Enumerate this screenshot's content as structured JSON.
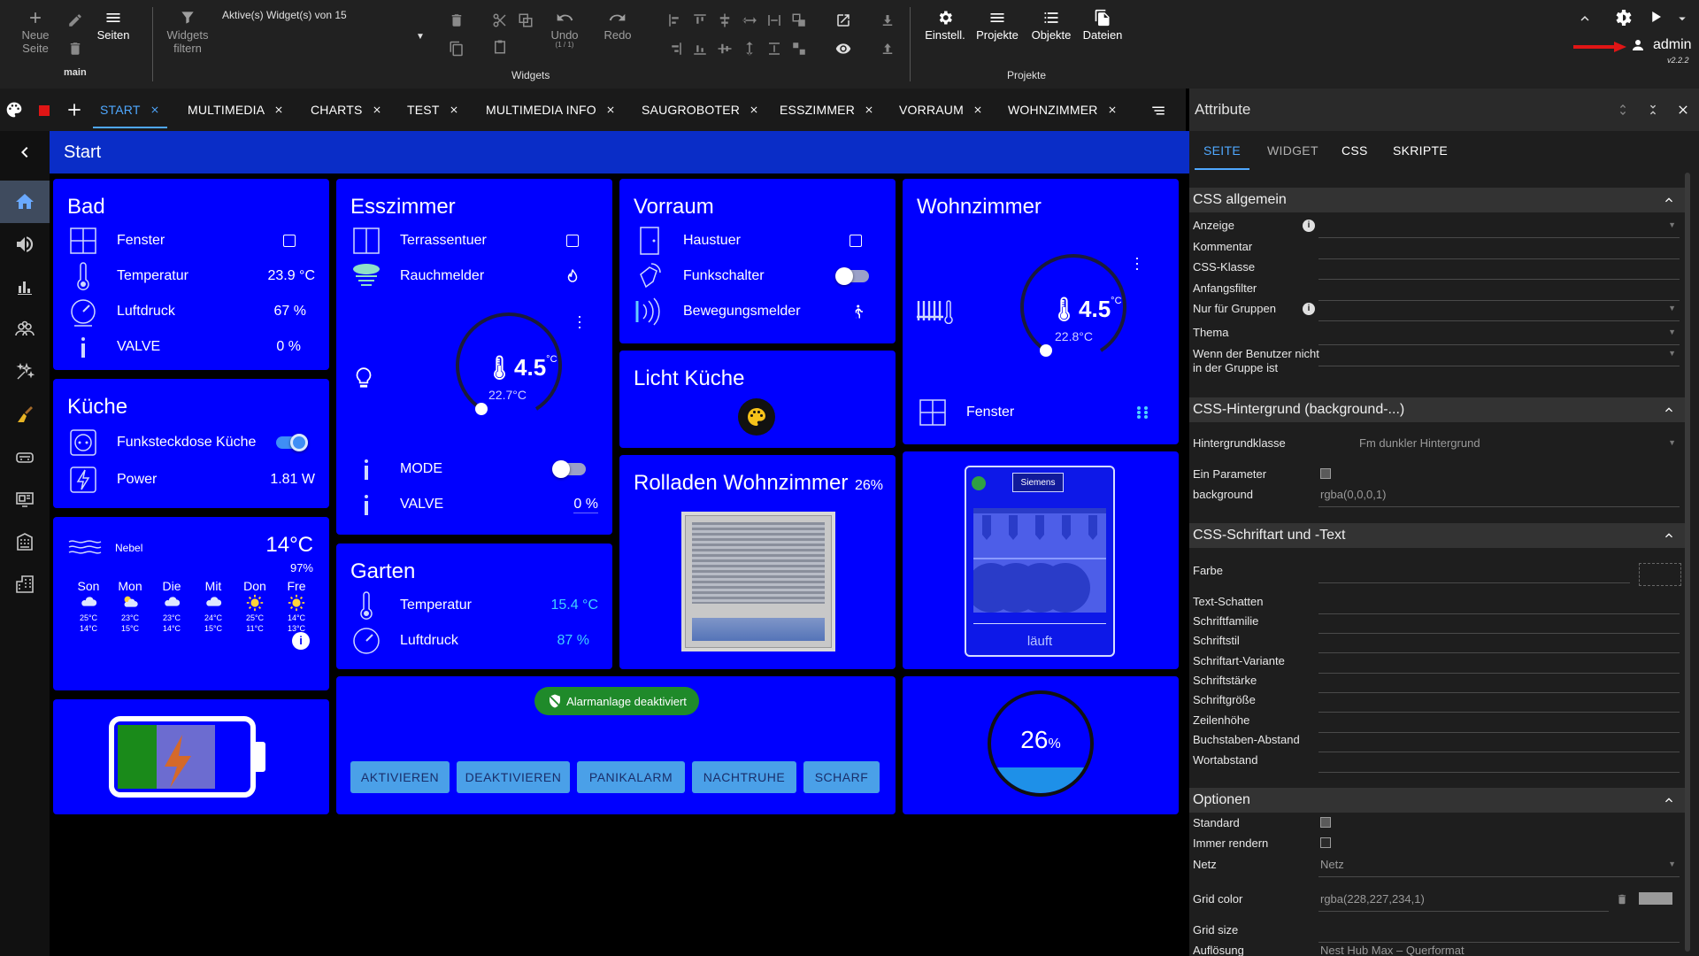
{
  "toolbar": {
    "new_page": "Neue Seite",
    "pages": "Seiten",
    "main": "main",
    "filter_widgets": "Widgets filtern",
    "active_widgets": "Aktive(s) Widget(s) von 15",
    "undo": "Undo",
    "undo_count": "(1 / 1)",
    "redo": "Redo",
    "widgets_group": "Widgets",
    "settings": "Einstell.",
    "projects": "Projekte",
    "objects": "Objekte",
    "files": "Dateien",
    "projects_group": "Projekte",
    "user": "admin",
    "version": "v2.2.2"
  },
  "tabs": [
    "START",
    "MULTIMEDIA",
    "CHARTS",
    "TEST",
    "MULTIMEDIA INFO",
    "SAUGROBOTER",
    "ESSZIMMER",
    "VORRAUM",
    "WOHNZIMMER"
  ],
  "page_title": "Start",
  "sidebar_icons": [
    "home-icon",
    "speaker-icon",
    "chart-icon",
    "group-icon",
    "sparkle-icon",
    "broom-icon",
    "robot-vacuum-icon",
    "monitor-icon",
    "building-icon",
    "apartment-icon"
  ],
  "bad": {
    "title": "Bad",
    "rows": [
      {
        "label": "Fenster",
        "value": ""
      },
      {
        "label": "Temperatur",
        "value": "23.9 °C"
      },
      {
        "label": "Luftdruck",
        "value": "67 %"
      },
      {
        "label": "VALVE",
        "value": "0 %"
      }
    ]
  },
  "kueche": {
    "title": "Küche",
    "plug": "Funksteckdose Küche",
    "power_label": "Power",
    "power_value": "1.81 W",
    "plug_on": true
  },
  "weather": {
    "condition": "Nebel",
    "temp": "14°C",
    "humidity": "97%",
    "days": [
      {
        "day": "Son",
        "icon": "cloud-icon",
        "hi": "25°C",
        "lo": "14°C"
      },
      {
        "day": "Mon",
        "icon": "cloud-sun-icon",
        "hi": "23°C",
        "lo": "15°C"
      },
      {
        "day": "Die",
        "icon": "cloud-icon",
        "hi": "23°C",
        "lo": "14°C"
      },
      {
        "day": "Mit",
        "icon": "cloud-icon",
        "hi": "24°C",
        "lo": "15°C"
      },
      {
        "day": "Don",
        "icon": "sun-icon",
        "hi": "25°C",
        "lo": "11°C"
      },
      {
        "day": "Fre",
        "icon": "sun-icon",
        "hi": "14°C",
        "lo": "13°C"
      }
    ]
  },
  "battery": {
    "level": 0.3
  },
  "esszimmer": {
    "title": "Esszimmer",
    "door": "Terrassentuer",
    "smoke": "Rauchmelder",
    "set": "4.5",
    "unit": "°C",
    "actual": "22.7°C",
    "mode": "MODE",
    "valve": "VALVE",
    "valve_value": "0 %"
  },
  "garten": {
    "title": "Garten",
    "temp_label": "Temperatur",
    "temp_value": "15.4 °C",
    "press_label": "Luftdruck",
    "press_value": "87 %"
  },
  "alarm": {
    "status": "Alarmanlage deaktiviert",
    "buttons": [
      "AKTIVIEREN",
      "DEAKTIVIEREN",
      "PANIKALARM",
      "NACHTRUHE",
      "SCHARF"
    ]
  },
  "vorraum": {
    "title": "Vorraum",
    "door": "Haustuer",
    "switch": "Funkschalter",
    "motion": "Bewegungsmelder"
  },
  "licht": {
    "title": "Licht Küche"
  },
  "rolladen": {
    "title": "Rolladen Wohnzimmer",
    "value": "26%"
  },
  "wohnzimmer": {
    "title": "Wohnzimmer",
    "set": "4.5",
    "unit": "°C",
    "actual": "22.8°C",
    "window": "Fenster"
  },
  "dishwasher": {
    "brand": "Siemens",
    "status": "läuft"
  },
  "gauge": {
    "value": "26",
    "unit": "%",
    "level": 0.26
  },
  "colors": {
    "card": "#0000ff",
    "header": "#0a2dc7",
    "accent": "#4fa8ff",
    "alarm_green": "#1f8a2a"
  },
  "panel": {
    "title": "Attribute",
    "tabs": [
      "SEITE",
      "WIDGET",
      "CSS",
      "SKRIPTE"
    ],
    "sec_css": "CSS allgemein",
    "css_rows": [
      "Anzeige",
      "Kommentar",
      "CSS-Klasse",
      "Anfangsfilter",
      "Nur für Gruppen",
      "Thema",
      "Wenn der Benutzer nicht in der Gruppe ist"
    ],
    "sec_bg": "CSS-Hintergrund (background-...)",
    "bg_class_label": "Hintergrundklasse",
    "bg_class_value": "Fm dunkler Hintergrund",
    "one_param": "Ein Parameter",
    "bg_label": "background",
    "bg_value": "rgba(0,0,0,1)",
    "sec_font": "CSS-Schriftart und -Text",
    "font_rows": [
      "Farbe",
      "Text-Schatten",
      "Schriftfamilie",
      "Schriftstil",
      "Schriftart-Variante",
      "Schriftstärke",
      "Schriftgröße",
      "Zeilenhöhe",
      "Buchstaben-Abstand",
      "Wortabstand"
    ],
    "sec_opts": "Optionen",
    "standard": "Standard",
    "always_render": "Immer rendern",
    "grid_label": "Netz",
    "grid_value": "Netz",
    "grid_color_label": "Grid color",
    "grid_color_value": "rgba(228,227,234,1)",
    "grid_size": "Grid size",
    "resolution_label": "Auflösung",
    "resolution_value": "Nest Hub Max – Querformat"
  }
}
